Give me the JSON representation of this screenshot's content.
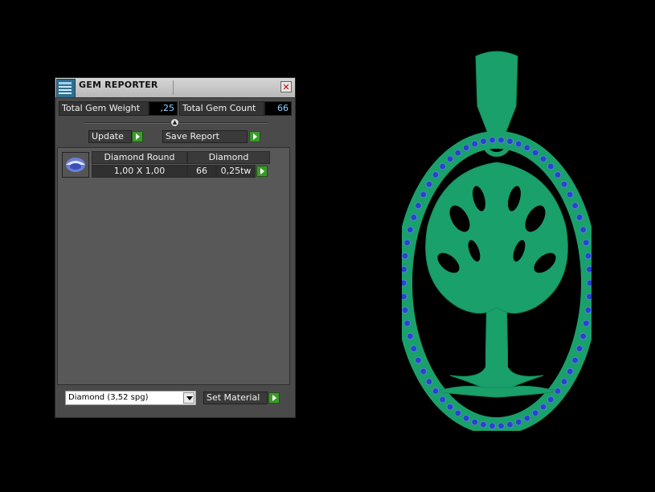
{
  "panel": {
    "title": "GEM REPORTER",
    "close_glyph": "✕",
    "total_weight_label": "Total Gem Weight",
    "total_weight_value": ",25",
    "total_count_label": "Total Gem Count",
    "total_count_value": "66",
    "update_label": "Update",
    "save_report_label": "Save Report",
    "gems": [
      {
        "shape": "Diamond Round",
        "material": "Diamond",
        "size": "1,00 X 1,00",
        "count": "66",
        "weight": "0,25tw"
      }
    ],
    "material_select": "Diamond     (3,52 spg)",
    "set_material_label": "Set Material"
  },
  "colors": {
    "metal": "#1aa06a",
    "gem": "#2745c8",
    "accent_button": "#3c9a2a"
  },
  "icons": {
    "app": "gem-reporter-icon",
    "play": "play-icon",
    "gem": "round-gem-icon",
    "dropdown": "chevron-down-icon"
  }
}
